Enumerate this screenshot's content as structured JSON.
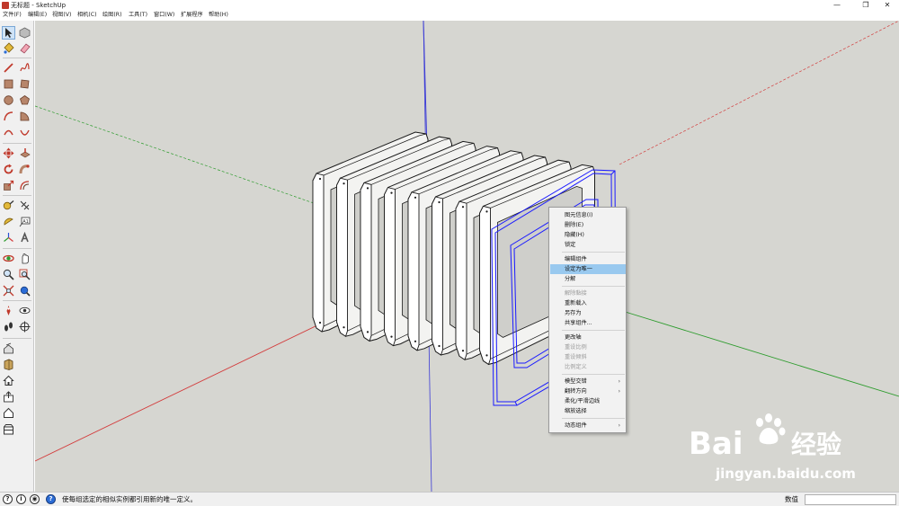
{
  "window": {
    "title": "无标题 - SketchUp",
    "minimize_glyph": "—",
    "restore_glyph": "❐",
    "close_glyph": "✕"
  },
  "menubar": {
    "items": [
      "文件(F)",
      "编辑(E)",
      "视图(V)",
      "相机(C)",
      "绘图(R)",
      "工具(T)",
      "窗口(W)",
      "扩展程序",
      "帮助(H)"
    ]
  },
  "toolbar": {
    "tools": [
      "select-icon",
      "component-icon",
      "paint-bucket-icon",
      "eraser-icon",
      "line-icon",
      "freehand-icon",
      "rectangle-icon",
      "rotated-rectangle-icon",
      "circle-icon",
      "polygon-icon",
      "arc-icon",
      "pie-icon",
      "two-point-arc-icon",
      "three-point-arc-icon",
      "move-icon",
      "push-pull-icon",
      "rotate-icon",
      "follow-me-icon",
      "scale-icon",
      "offset-icon",
      "tape-measure-icon",
      "dimension-icon",
      "protractor-icon",
      "text-icon",
      "axes-icon",
      "3d-text-icon",
      "orbit-icon",
      "pan-icon",
      "zoom-icon",
      "zoom-window-icon",
      "zoom-extents-icon",
      "previous-view-icon",
      "position-camera-icon",
      "look-around-icon",
      "walk-icon",
      "section-plane-icon",
      "warehouse-icon",
      "extension-warehouse-icon",
      "home-icon",
      "share-icon",
      "house-icon",
      "storage-icon"
    ],
    "active": "select-icon"
  },
  "context_menu": {
    "items": [
      {
        "label": "图元信息(I)",
        "enabled": true,
        "submenu": false
      },
      {
        "label": "删除(E)",
        "enabled": true,
        "submenu": false
      },
      {
        "label": "隐藏(H)",
        "enabled": true,
        "submenu": false
      },
      {
        "label": "锁定",
        "enabled": true,
        "submenu": false
      },
      {
        "label": "编辑组件",
        "enabled": true,
        "submenu": false
      },
      {
        "label": "设定为唯一",
        "enabled": true,
        "submenu": false,
        "highlighted": true
      },
      {
        "label": "分解",
        "enabled": true,
        "submenu": false
      },
      {
        "label": "解除黏接",
        "enabled": false,
        "submenu": false
      },
      {
        "label": "重新载入",
        "enabled": true,
        "submenu": false
      },
      {
        "label": "另存为",
        "enabled": true,
        "submenu": false
      },
      {
        "label": "共享组件...",
        "enabled": true,
        "submenu": false
      },
      {
        "label": "更改轴",
        "enabled": true,
        "submenu": false
      },
      {
        "label": "重设比例",
        "enabled": false,
        "submenu": false
      },
      {
        "label": "重设倾斜",
        "enabled": false,
        "submenu": false
      },
      {
        "label": "比例定义",
        "enabled": false,
        "submenu": false
      },
      {
        "label": "模型交错",
        "enabled": true,
        "submenu": true
      },
      {
        "label": "翻转方向",
        "enabled": true,
        "submenu": true
      },
      {
        "label": "柔化/平滑边线",
        "enabled": true,
        "submenu": false
      },
      {
        "label": "缩放选择",
        "enabled": true,
        "submenu": false
      },
      {
        "label": "动态组件",
        "enabled": true,
        "submenu": true
      }
    ],
    "submenu_arrow": "›"
  },
  "statusbar": {
    "icons": [
      "info-icon",
      "info-icon",
      "user-icon",
      "help-icon"
    ],
    "message": "使每组选定的相似实例都引用新的唯一定义。",
    "measurements_label": "数值",
    "measurements_value": ""
  },
  "watermark": {
    "brand": "Bai",
    "brand_tail": "经验",
    "url": "jingyan.baidu.com"
  },
  "colors": {
    "viewport_bg": "#d6d6d1",
    "axis_red": "#d33c3c",
    "axis_green": "#2e9c2e",
    "axis_blue": "#3b3bd6",
    "selection": "#1a1aff",
    "highlight": "#99c9ef"
  }
}
